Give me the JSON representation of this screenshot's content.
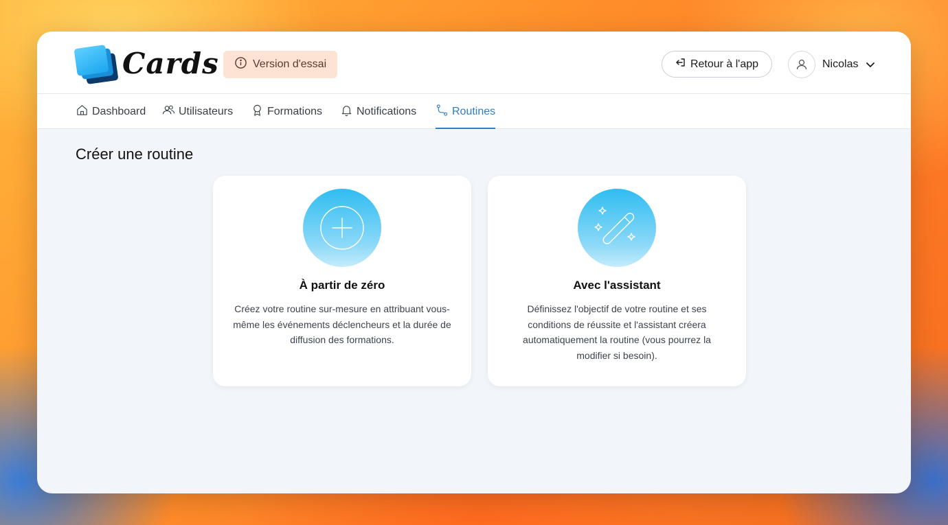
{
  "app": {
    "logo_text": "Cards"
  },
  "header": {
    "trial_badge": "Version d'essai",
    "back_button": "Retour à l'app",
    "user_name": "Nicolas"
  },
  "nav": {
    "items": [
      {
        "label": "Dashboard",
        "icon": "home-icon"
      },
      {
        "label": "Utilisateurs",
        "icon": "users-icon"
      },
      {
        "label": "Formations",
        "icon": "award-icon"
      },
      {
        "label": "Notifications",
        "icon": "bell-icon"
      },
      {
        "label": "Routines",
        "icon": "route-icon",
        "active": true
      }
    ]
  },
  "main": {
    "title": "Créer une routine",
    "cards": [
      {
        "title": "À partir de zéro",
        "description": "Créez votre routine sur-mesure en attribuant vous-même les événements déclencheurs et la durée de diffusion des formations.",
        "icon": "plus-circle-icon"
      },
      {
        "title": "Avec l'assistant",
        "description": "Définissez l'objectif de votre routine et ses conditions de réussite et l'assistant créera automatiquement la routine (vous pourrez la modifier si besoin).",
        "icon": "magic-wand-icon"
      }
    ]
  },
  "colors": {
    "accent": "#2e7fc1",
    "trial_badge_bg": "#fde3d3",
    "icon_gradient_top": "#2fbdf0",
    "icon_gradient_bottom": "#c4ecfb",
    "page_bg": "#f2f5f9"
  }
}
